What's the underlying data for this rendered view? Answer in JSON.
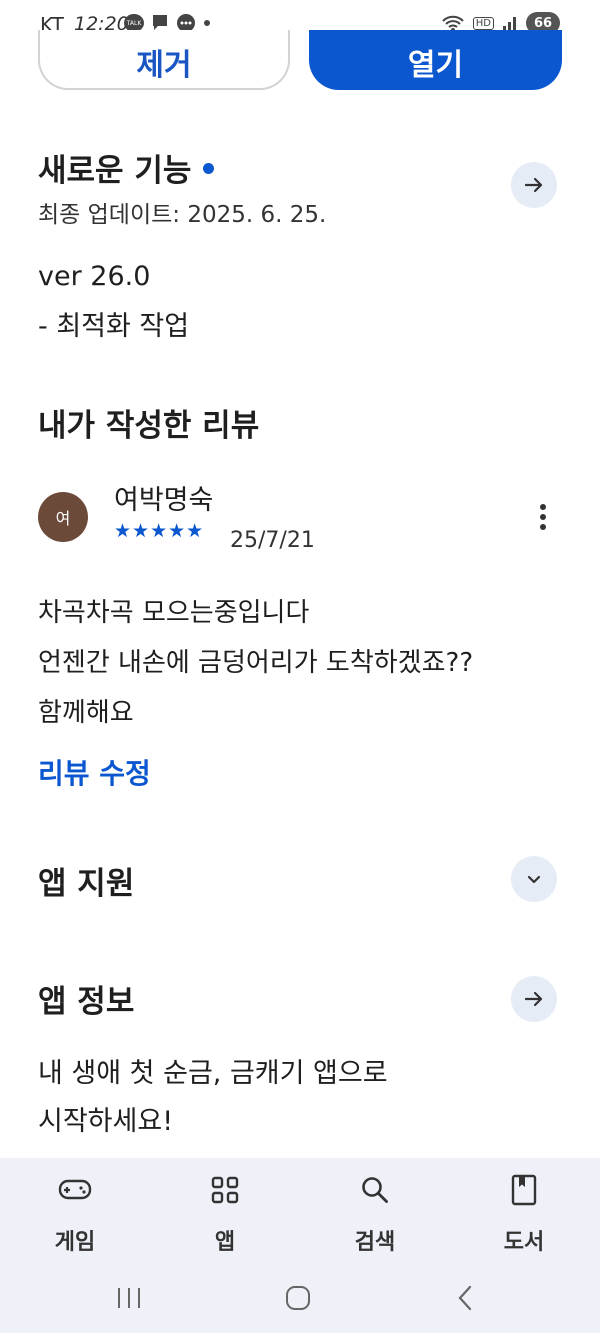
{
  "status_bar": {
    "carrier": "KT",
    "time": "12:20",
    "battery": "66",
    "hd": "HD"
  },
  "actions": {
    "remove_label": "제거",
    "open_label": "열기"
  },
  "whats_new": {
    "title": "새로운 기능",
    "updated": "최종 업데이트: 2025. 6. 25.",
    "lines": [
      "ver 26.0",
      "- 최적화 작업"
    ]
  },
  "my_review": {
    "title": "내가 작성한 리뷰",
    "avatar_initial": "여",
    "reviewer": "여박명숙",
    "rating": 5,
    "stars": "★★★★★",
    "date": "25/7/21",
    "lines": [
      "차곡차곡 모으는중입니다",
      "언젠간 내손에 금덩어리가 도착하겠죠??",
      "함께해요"
    ],
    "edit_label": "리뷰 수정"
  },
  "app_support": {
    "title": "앱 지원"
  },
  "app_info": {
    "title": "앱 정보",
    "lines": [
      "내 생애 첫 순금, 금캐기 앱으로",
      "시작하세요!"
    ]
  },
  "bottom_nav": {
    "items": [
      {
        "label": "게임",
        "icon": "gamepad-icon"
      },
      {
        "label": "앱",
        "icon": "apps-grid-icon"
      },
      {
        "label": "검색",
        "icon": "search-icon"
      },
      {
        "label": "도서",
        "icon": "book-icon"
      }
    ]
  },
  "colors": {
    "accent": "#0b57d0",
    "circle_button": "#e6ecf6",
    "nav_bg": "#eef2f8"
  }
}
